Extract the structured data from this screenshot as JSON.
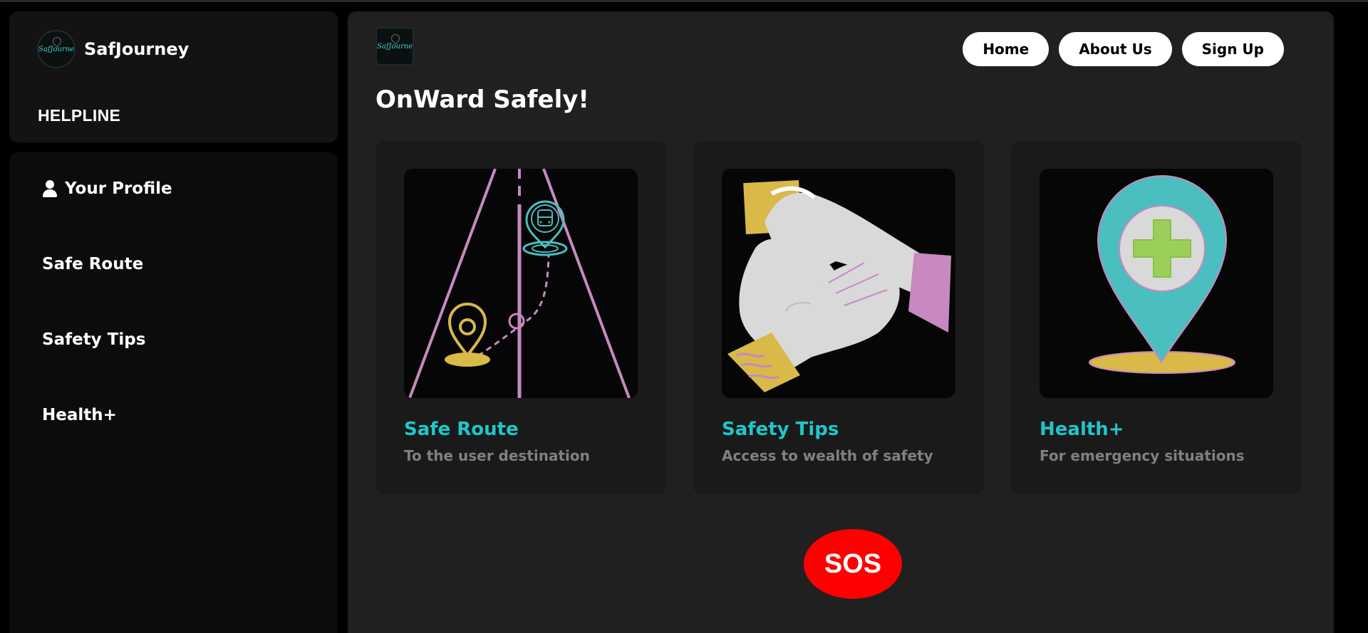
{
  "brand": {
    "name": "SafJourney",
    "logo_text": "SafJourney"
  },
  "sidebar": {
    "helpline_label": "HELPLINE",
    "items": [
      {
        "label": "Your Profile",
        "icon": "user-icon"
      },
      {
        "label": "Safe Route"
      },
      {
        "label": "Safety Tips"
      },
      {
        "label": "Health+"
      }
    ]
  },
  "header": {
    "nav": [
      {
        "label": "Home"
      },
      {
        "label": "About Us"
      },
      {
        "label": "Sign Up"
      }
    ]
  },
  "main": {
    "headline": "OnWard Safely!",
    "cards": [
      {
        "title": "Safe Route",
        "subtitle": "To the user destination",
        "icon": "road-route-illustration"
      },
      {
        "title": "Safety Tips",
        "subtitle": "Access to wealth of safety",
        "icon": "stacked-hands-illustration"
      },
      {
        "title": "Health+",
        "subtitle": "For emergency situations",
        "icon": "medical-pin-illustration"
      }
    ],
    "sos_label": "SOS"
  },
  "colors": {
    "accent": "#1fc6c9",
    "sos": "#ff0000",
    "panel": "#202020",
    "sidebar": "#131313",
    "muted_text": "#808080"
  }
}
